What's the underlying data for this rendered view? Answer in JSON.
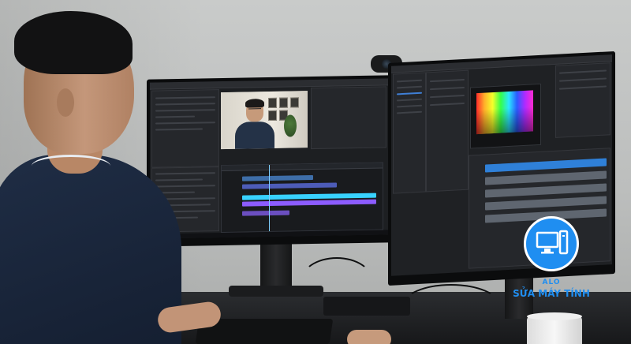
{
  "scene": {
    "subject": "person-editing-video-on-dual-monitors",
    "colors": {
      "accent_logo": "#1f8ef1",
      "timeline_cyan": "#38d2ff",
      "timeline_purple": "#8c5cff",
      "shirt": "#1f2d45"
    }
  },
  "watermark": {
    "line1": "ALO",
    "line2": "SỬA MÁY TÍNH",
    "icon": "computer-monitor-tower-icon"
  }
}
